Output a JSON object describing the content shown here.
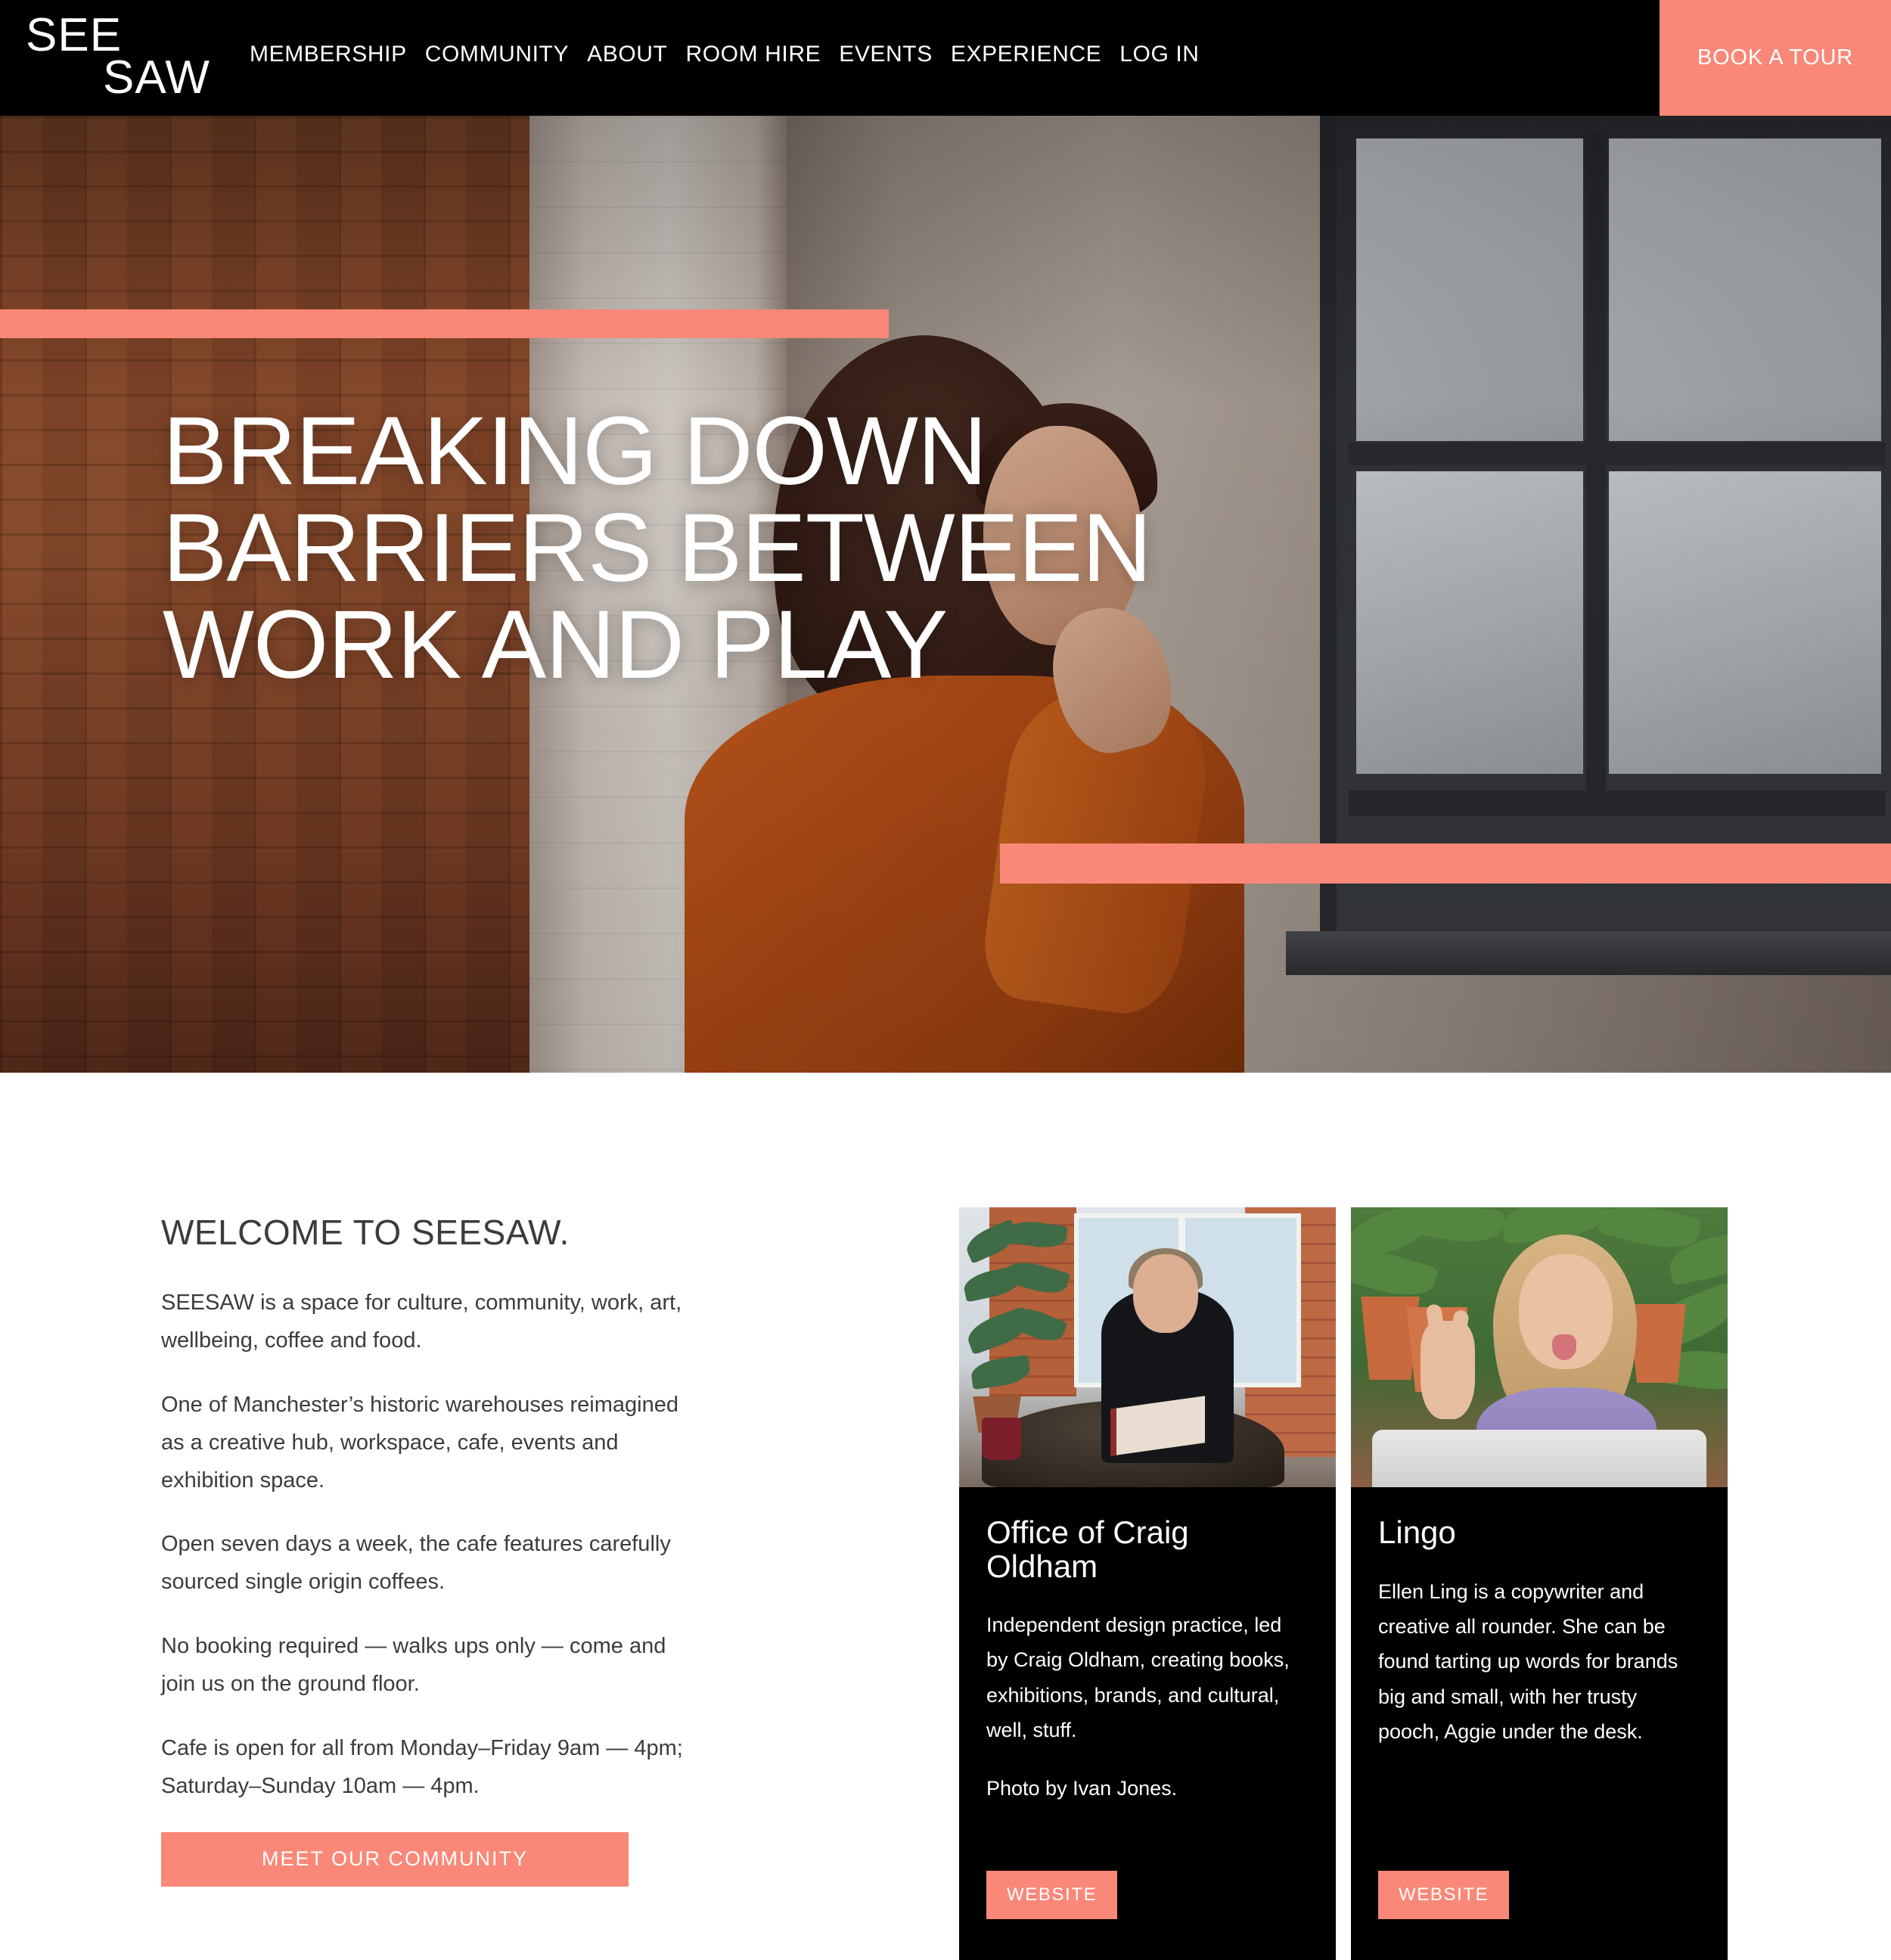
{
  "brand": {
    "logo_line1": "SEE",
    "logo_line2": "SAW"
  },
  "colors": {
    "accent_coral": "#f98878",
    "header_bg": "#000000",
    "body_text": "#3c3c3c",
    "card_bg": "#000000"
  },
  "header": {
    "nav": [
      {
        "label": "MEMBERSHIP"
      },
      {
        "label": "COMMUNITY"
      },
      {
        "label": "ABOUT"
      },
      {
        "label": "ROOM HIRE"
      },
      {
        "label": "EVENTS"
      },
      {
        "label": "EXPERIENCE"
      },
      {
        "label": "LOG IN"
      }
    ],
    "cta_label": "BOOK A TOUR"
  },
  "hero": {
    "headline_line1": "BREAKING DOWN",
    "headline_line2": "BARRIERS BETWEEN",
    "headline_line3": "WORK AND PLAY"
  },
  "welcome": {
    "title": "WELCOME TO SEESAW.",
    "paragraphs": [
      "SEESAW is a space for culture, community, work, art, wellbeing, coffee and food.",
      "One of Manchester’s historic warehouses reimagined as a creative hub, workspace, cafe, events and exhibition space.",
      "Open seven days a week, the cafe features carefully sourced single origin coffees.",
      "No booking required — walks ups only — come and join us on the ground floor.",
      "Cafe is open for all from Monday–Friday 9am — 4pm; Saturday–Sunday 10am — 4pm."
    ],
    "cta_label": "MEET OUR COMMUNITY"
  },
  "cards": [
    {
      "title": "Office of Craig Oldham",
      "description": "Independent design practice, led by Craig Oldham, creating books, exhibitions, brands, and cultural, well, stuff.",
      "credit": "Photo by Ivan Jones.",
      "button_label": "WEBSITE"
    },
    {
      "title": "Lingo",
      "description": "Ellen Ling is a copywriter and creative all rounder. She can be found tarting up words for brands big and small, with her trusty pooch, Aggie under the desk.",
      "credit": "",
      "button_label": "WEBSITE"
    }
  ]
}
